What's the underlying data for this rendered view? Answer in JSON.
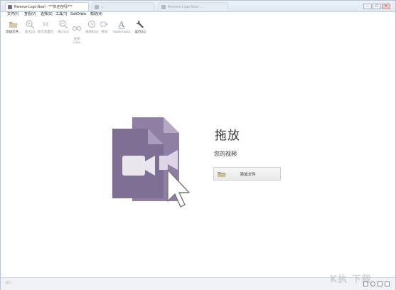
{
  "window": {
    "tabs": [
      {
        "label": "Remove Logo Now! - ***你还在吗!***",
        "active": true
      },
      {
        "label": "...",
        "active": false
      },
      {
        "label": "Remove Logo Now! ...",
        "active": false
      }
    ],
    "controls": [
      "-",
      "□",
      "×"
    ]
  },
  "menu": {
    "items": [
      "文件(F)",
      "查看(V)",
      "选择(S)",
      "工具(T)",
      "SoftOrbits",
      "帮助(H)"
    ]
  },
  "toolbar": {
    "items": [
      {
        "label": "添加文件...",
        "icon": "folder-open-icon",
        "enabled": true
      },
      {
        "label": "放大(Z)",
        "icon": "zoom-in-icon",
        "enabled": false
      },
      {
        "label": "放大到最佳",
        "icon": "zoom-fit-icon",
        "enabled": false
      },
      {
        "label": "缩小(O)",
        "icon": "zoom-out-icon",
        "enabled": false
      },
      {
        "label": "查找\nLogo",
        "icon": "binoculars-icon",
        "enabled": false
      },
      {
        "label": "清除标记",
        "icon": "clock-clear-icon",
        "enabled": false
      },
      {
        "label": "移除",
        "icon": "forward-icon",
        "enabled": false
      },
      {
        "label": "Watermarks",
        "icon": "text-a-icon",
        "enabled": false
      },
      {
        "label": "运行(U)",
        "icon": "wrench-icon",
        "enabled": true
      }
    ]
  },
  "main": {
    "title": "拖放",
    "subtitle": "您的视频",
    "add_button_label": "添加文件"
  },
  "status": {
    "left_text": "◁ ▷"
  },
  "watermark_text": "K执 下载",
  "colors": {
    "accent_purple": "#8a7b9e",
    "accent_purple_dark": "#7a6a8f"
  }
}
